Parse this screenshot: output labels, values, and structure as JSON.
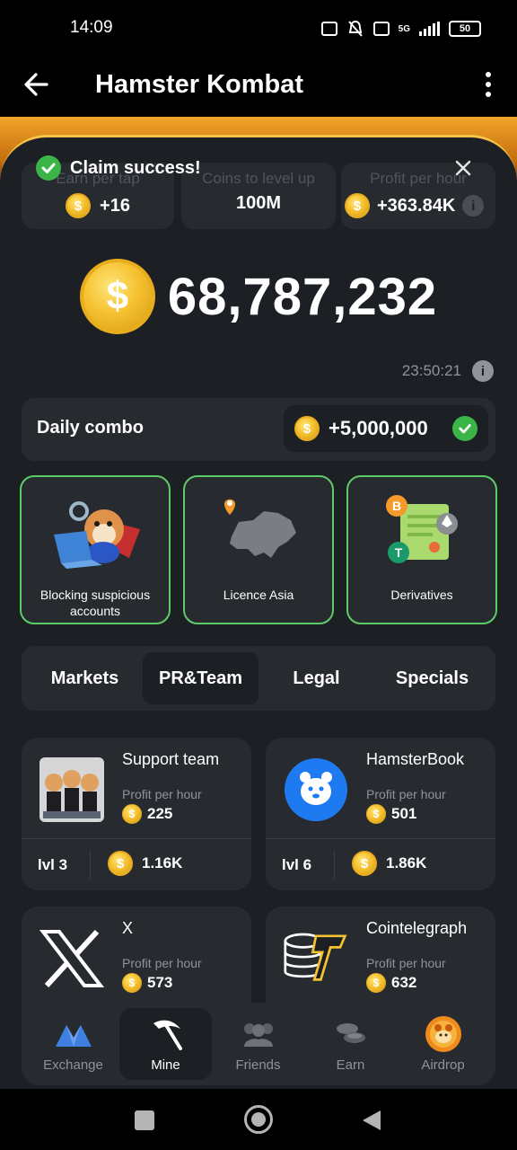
{
  "status_bar": {
    "time": "14:09",
    "network": "5G",
    "battery": "50"
  },
  "app_bar": {
    "title": "Hamster Kombat"
  },
  "toast": {
    "message": "Claim success!"
  },
  "stats": [
    {
      "label": "Earn per tap",
      "value": "+16",
      "coin": true
    },
    {
      "label": "Coins to level up",
      "value": "100M",
      "coin": false
    },
    {
      "label": "Profit per hour",
      "value": "+363.84K",
      "coin": true,
      "info": true
    }
  ],
  "balance": {
    "value": "68,787,232",
    "coin_symbol": "$"
  },
  "timer": {
    "value": "23:50:21"
  },
  "daily_combo": {
    "label": "Daily combo",
    "reward": "+5,000,000"
  },
  "combo_cards": [
    {
      "label": "Blocking suspicious accounts",
      "icon": "hamster-laptop-icon"
    },
    {
      "label": "Licence Asia",
      "icon": "asia-map-icon"
    },
    {
      "label": "Derivatives",
      "icon": "crypto-document-icon"
    }
  ],
  "tabs": [
    {
      "label": "Markets",
      "active": false
    },
    {
      "label": "PR&Team",
      "active": true
    },
    {
      "label": "Legal",
      "active": false
    },
    {
      "label": "Specials",
      "active": false
    }
  ],
  "upgrades": [
    {
      "name": "Support team",
      "profit_label": "Profit per hour",
      "profit": "225",
      "level": "lvl 3",
      "cost": "1.16K",
      "icon": "support-team-icon"
    },
    {
      "name": "HamsterBook",
      "profit_label": "Profit per hour",
      "profit": "501",
      "level": "lvl 6",
      "cost": "1.86K",
      "icon": "hamsterbook-icon"
    },
    {
      "name": "X",
      "profit_label": "Profit per hour",
      "profit": "573",
      "icon": "x-logo-icon"
    },
    {
      "name": "Cointelegraph",
      "profit_label": "Profit per hour",
      "profit": "632",
      "icon": "cointelegraph-icon"
    }
  ],
  "bottom_nav": [
    {
      "label": "Exchange",
      "icon": "exchange-icon",
      "active": false
    },
    {
      "label": "Mine",
      "icon": "pickaxe-icon",
      "active": true
    },
    {
      "label": "Friends",
      "icon": "friends-icon",
      "active": false
    },
    {
      "label": "Earn",
      "icon": "coins-icon",
      "active": false
    },
    {
      "label": "Airdrop",
      "icon": "airdrop-icon",
      "active": false
    }
  ],
  "colors": {
    "background": "#1c1f24",
    "card": "#272a2f",
    "accent_gold": "#f6c231",
    "success_green": "#3bb546",
    "combo_border": "#5ecb6a"
  }
}
